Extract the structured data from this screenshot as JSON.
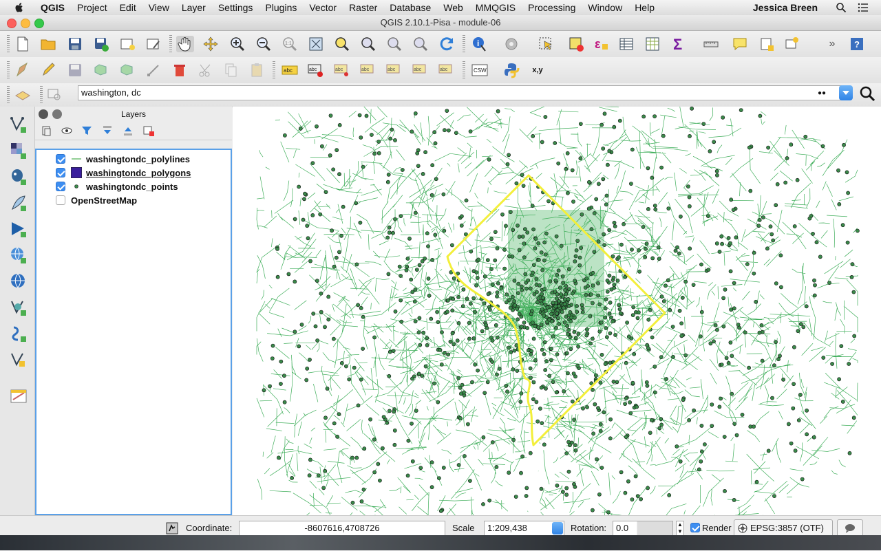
{
  "menubar": {
    "app": "QGIS",
    "items": [
      "Project",
      "Edit",
      "View",
      "Layer",
      "Settings",
      "Plugins",
      "Vector",
      "Raster",
      "Database",
      "Web",
      "MMQGIS",
      "Processing",
      "Window",
      "Help"
    ],
    "user": "Jessica Breen"
  },
  "window": {
    "title": "QGIS 2.10.1-Pisa - module-06"
  },
  "search": {
    "value": "washington, dc"
  },
  "layers_panel": {
    "title": "Layers",
    "layers": [
      {
        "name": "washingtondc_polylines",
        "checked": true,
        "symbol": "line",
        "color": "#4caf50"
      },
      {
        "name": "washingtondc_polygons",
        "checked": true,
        "symbol": "fill",
        "color": "#3a1e9c"
      },
      {
        "name": "washingtondc_points",
        "checked": true,
        "symbol": "point",
        "color": "#2e7d32"
      },
      {
        "name": "OpenStreetMap",
        "checked": false,
        "symbol": "none"
      }
    ]
  },
  "statusbar": {
    "coordinate_label": "Coordinate:",
    "coordinate_value": "-8607616,4708726",
    "scale_label": "Scale",
    "scale_value": "1:209,438",
    "rotation_label": "Rotation:",
    "rotation_value": "0.0",
    "render_label": "Render",
    "render_checked": true,
    "crs": "EPSG:3857 (OTF)"
  },
  "colors": {
    "accent": "#3d8ef1",
    "streets": "#3fae5a",
    "points": "#3a8a4a",
    "boundary": "#f3ef3a"
  }
}
